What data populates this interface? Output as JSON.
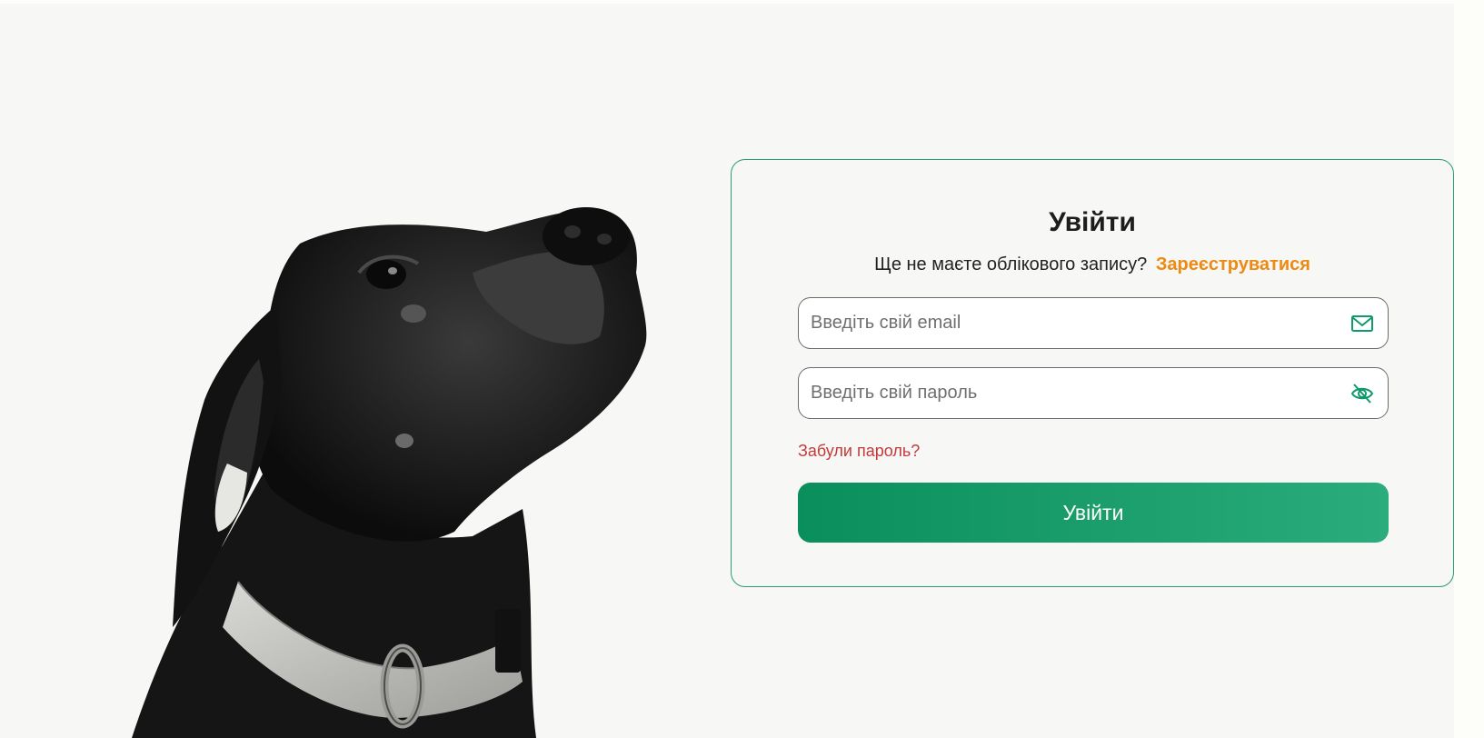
{
  "login": {
    "title": "Увійти",
    "subtitle": "Ще не маєте облікового запису?",
    "register_link": "Зареєструватися",
    "email_placeholder": "Введіть свій email",
    "password_placeholder": "Введіть свій пароль",
    "forgot_password": "Забули пароль?",
    "submit_label": "Увійти"
  },
  "icons": {
    "email": "mail-icon",
    "password_toggle": "eye-off-icon",
    "photo": "dog-photo"
  },
  "colors": {
    "accent_green": "#1c9f6c",
    "register_orange": "#ee8a12",
    "forgot_red": "#c23b3b",
    "background": "#f7f7f6"
  }
}
